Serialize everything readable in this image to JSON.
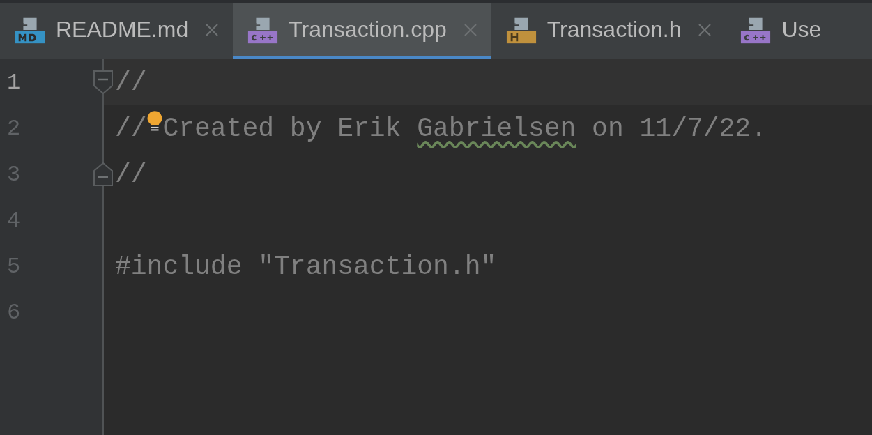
{
  "tabs": [
    {
      "label": "README.md",
      "kind": "md",
      "selected": false,
      "closable": true
    },
    {
      "label": "Transaction.cpp",
      "kind": "cpp",
      "selected": true,
      "closable": true
    },
    {
      "label": "Transaction.h",
      "kind": "h",
      "selected": false,
      "closable": true
    },
    {
      "label": "Use",
      "kind": "cpp",
      "selected": false,
      "closable": false
    }
  ],
  "editor": {
    "lines": [
      {
        "number": "1",
        "current": true,
        "kind": "fold-start",
        "intention": false,
        "segments": [
          {
            "text": "//",
            "typo": false
          }
        ]
      },
      {
        "number": "2",
        "current": false,
        "kind": "plain",
        "intention": true,
        "segments": [
          {
            "text": "//",
            "typo": false
          },
          {
            "text": "Created by Erik",
            "typo": false
          },
          {
            "text": "Gabrielsen",
            "typo": true
          },
          {
            "text": "on 11/7/22.",
            "typo": false
          }
        ]
      },
      {
        "number": "3",
        "current": false,
        "kind": "fold-end",
        "intention": false,
        "segments": [
          {
            "text": "//",
            "typo": false
          }
        ]
      },
      {
        "number": "4",
        "current": false,
        "kind": "plain",
        "intention": false
      },
      {
        "number": "5",
        "current": false,
        "kind": "plain",
        "intention": false,
        "segments": [
          {
            "text": "#include \"Transaction.h\"",
            "typo": false
          }
        ]
      },
      {
        "number": "6",
        "current": false,
        "kind": "plain",
        "intention": false
      }
    ]
  }
}
